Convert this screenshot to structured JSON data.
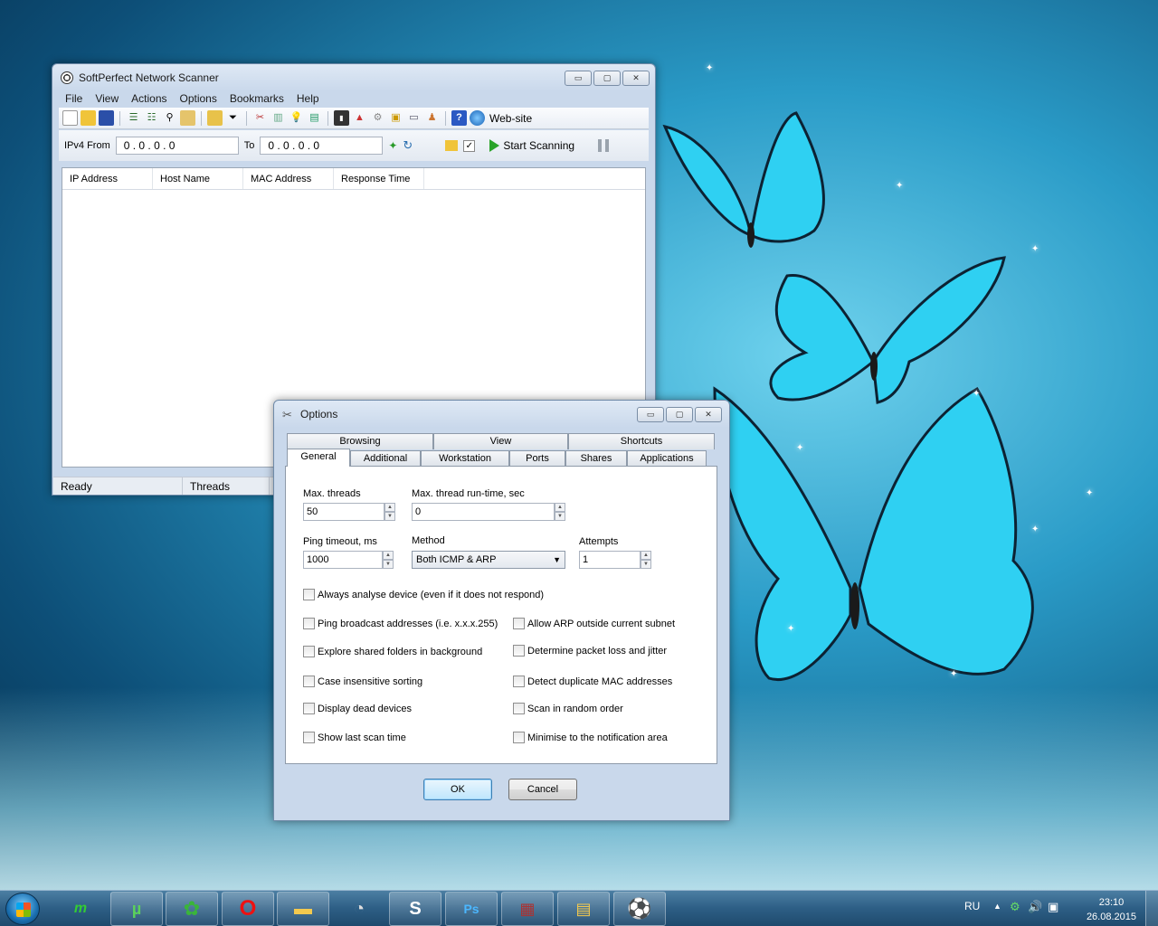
{
  "scanner": {
    "title": "SoftPerfect Network Scanner",
    "menu": [
      "File",
      "View",
      "Actions",
      "Options",
      "Bookmarks",
      "Help"
    ],
    "website_label": "Web-site",
    "ipv4_from_label": "IPv4 From",
    "ip_from": "0 . 0 . 0 . 0",
    "to_label": "To",
    "ip_to": "0 . 0 . 0 . 0",
    "start_label": "Start Scanning",
    "columns": [
      "IP Address",
      "Host Name",
      "MAC Address",
      "Response Time"
    ],
    "status": [
      "Ready",
      "Threads"
    ]
  },
  "options": {
    "title": "Options",
    "tabs_top": [
      "Browsing",
      "View",
      "Shortcuts"
    ],
    "tabs_bottom": [
      "General",
      "Additional",
      "Workstation",
      "Ports",
      "Shares",
      "Applications"
    ],
    "active_tab": "General",
    "max_threads_label": "Max. threads",
    "max_threads_value": "50",
    "max_runtime_label": "Max. thread run-time, sec",
    "max_runtime_value": "0",
    "ping_timeout_label": "Ping timeout, ms",
    "ping_timeout_value": "1000",
    "method_label": "Method",
    "method_value": "Both ICMP & ARP",
    "attempts_label": "Attempts",
    "attempts_value": "1",
    "checkbox_always": "Always analyse device (even if it does not respond)",
    "checkboxes_left": [
      "Ping broadcast addresses (i.e. x.x.x.255)",
      "Explore shared folders in background",
      "Case insensitive sorting",
      "Display dead devices",
      "Show last scan time"
    ],
    "checkboxes_right": [
      "Allow ARP outside current subnet",
      "Determine packet loss and jitter",
      "Detect duplicate MAC addresses",
      "Scan in random order",
      "Minimise to the notification area"
    ],
    "ok_label": "OK",
    "cancel_label": "Cancel"
  },
  "taskbar": {
    "language": "RU",
    "time": "23:10",
    "date": "26.08.2015"
  }
}
